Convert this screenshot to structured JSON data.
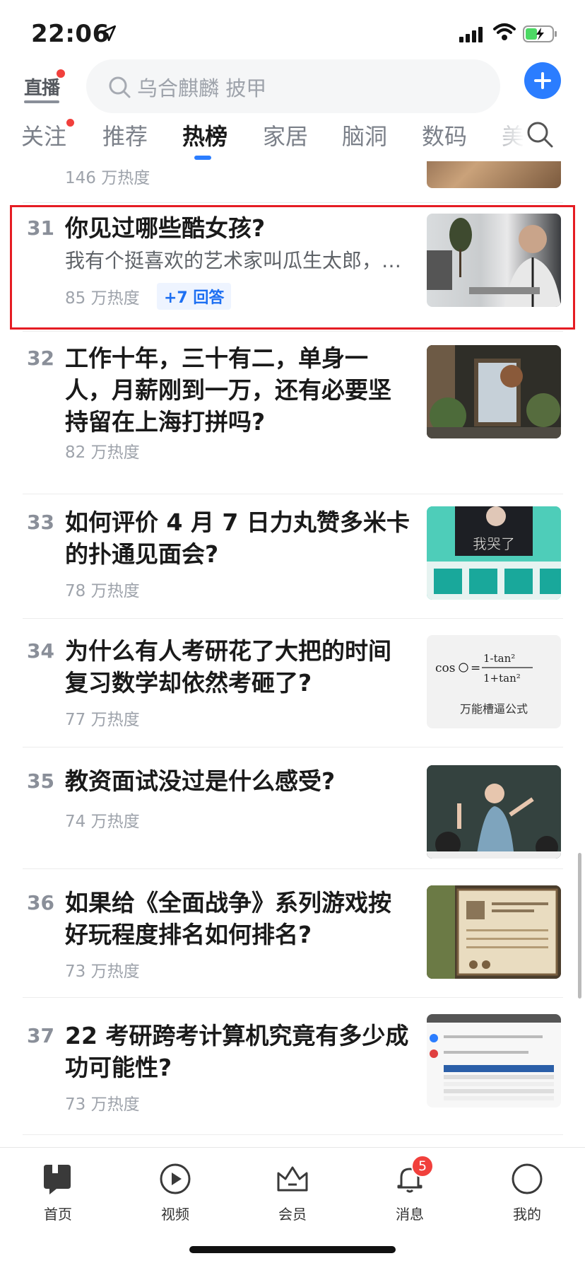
{
  "status_bar": {
    "time": "22:06"
  },
  "header": {
    "live_label": "直播",
    "search_placeholder": "乌合麒麟 披甲"
  },
  "tabs": [
    {
      "label": "关注"
    },
    {
      "label": "推荐"
    },
    {
      "label": "热榜"
    },
    {
      "label": "家居"
    },
    {
      "label": "脑洞"
    },
    {
      "label": "数码"
    },
    {
      "label": "美"
    }
  ],
  "prev_item": {
    "heat": "146 万热度"
  },
  "items": [
    {
      "rank": "31",
      "title": "你见过哪些酷女孩?",
      "excerpt": "我有个挺喜欢的艺术家叫瓜生太郎，…",
      "heat": "85 万热度",
      "answers": "+7 回答"
    },
    {
      "rank": "32",
      "title": "工作十年，三十有二，单身一人，月薪刚到一万，还有必要坚持留在上海打拼吗?",
      "heat": "82 万热度"
    },
    {
      "rank": "33",
      "title": "如何评价 4 月 7 日力丸赞多米卡的扑通见面会?",
      "heat": "78 万热度",
      "thumb_text": "我哭了"
    },
    {
      "rank": "34",
      "title": "为什么有人考研花了大把的时间复习数学却依然考砸了?",
      "heat": "77 万热度",
      "thumb_caption": "万能槽逼公式"
    },
    {
      "rank": "35",
      "title": "教资面试没过是什么感受?",
      "heat": "74 万热度"
    },
    {
      "rank": "36",
      "title": "如果给《全面战争》系列游戏按好玩程度排名如何排名?",
      "heat": "73 万热度"
    },
    {
      "rank": "37",
      "title": "22 考研跨考计算机究竟有多少成功可能性?",
      "heat": "73 万热度"
    }
  ],
  "bottom_nav": [
    {
      "label": "首页"
    },
    {
      "label": "视频"
    },
    {
      "label": "会员"
    },
    {
      "label": "消息",
      "badge": "5"
    },
    {
      "label": "我的"
    }
  ],
  "colors": {
    "accent": "#2b7dff",
    "highlight_box": "#e51c23",
    "badge": "#f1403c"
  }
}
